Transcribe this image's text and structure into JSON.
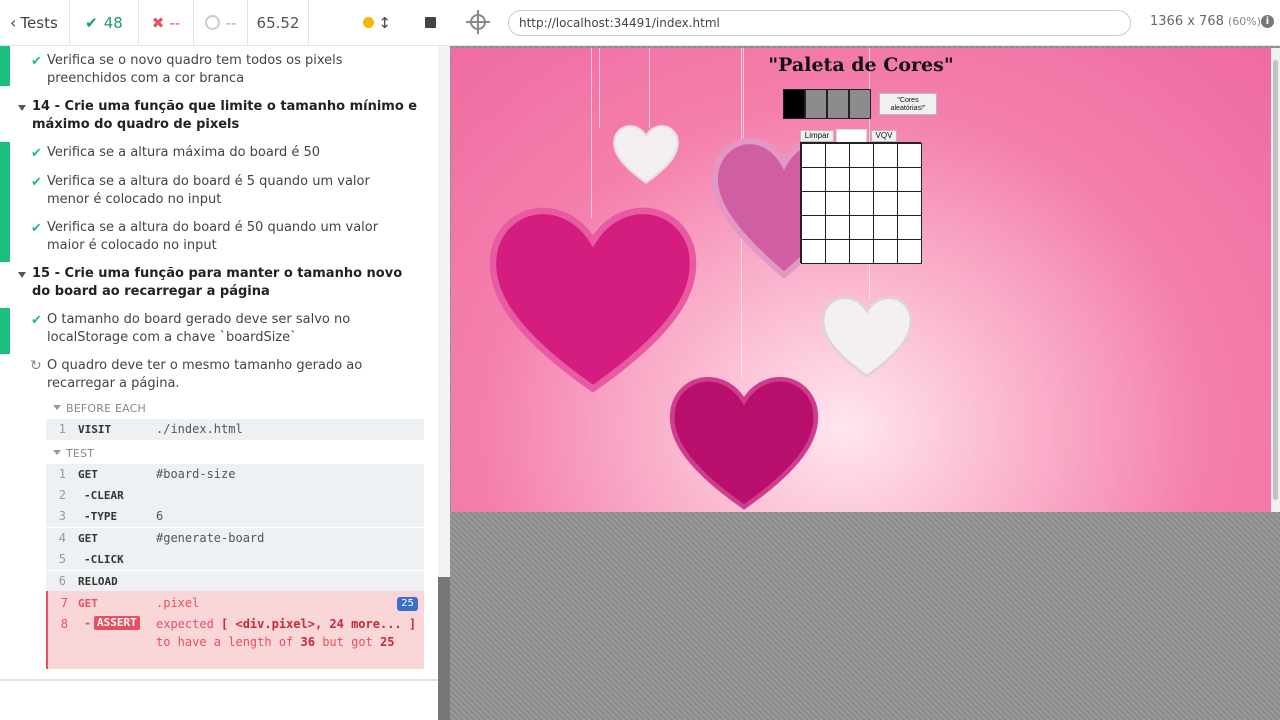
{
  "header": {
    "back_label": "Tests",
    "passed": "48",
    "failed": "--",
    "pending": "--",
    "duration": "65.52"
  },
  "tests": {
    "t13_last": "Verifica se o novo quadro tem todos os pixels preenchidos com a cor branca",
    "suite14": "14 - Crie uma função que limite o tamanho mínimo e máximo do quadro de pixels",
    "t14_1": "Verifica se a altura máxima do board é 50",
    "t14_2": "Verifica se a altura do board é 5 quando um valor menor é colocado no input",
    "t14_3": "Verifica se a altura do board é 50 quando um valor maior é colocado no input",
    "suite15": "15 - Crie uma função para manter o tamanho novo do board ao recarregar a página",
    "t15_1": "O tamanho do board gerado deve ser salvo no localStorage com a chave `boardSize`",
    "t15_2": "O quadro deve ter o mesmo tamanho gerado ao recarregar a página."
  },
  "hooks": {
    "before_each_label": "BEFORE EACH",
    "test_label": "TEST"
  },
  "before_each_cmds": [
    {
      "num": "1",
      "name": "VISIT",
      "arg": "./index.html"
    }
  ],
  "test_cmds": [
    {
      "num": "1",
      "name": "GET",
      "arg": "#board-size"
    },
    {
      "num": "2",
      "name": "-CLEAR",
      "arg": ""
    },
    {
      "num": "3",
      "name": "-TYPE",
      "arg": "6"
    },
    {
      "num": "4",
      "name": "GET",
      "arg": "#generate-board"
    },
    {
      "num": "5",
      "name": "-CLICK",
      "arg": ""
    },
    {
      "num": "6",
      "name": "RELOAD",
      "arg": ""
    }
  ],
  "failed_cmd": {
    "num7": "7",
    "name7": "GET",
    "arg7": ".pixel",
    "badge": "25",
    "num8": "8",
    "assert_label": "ASSERT",
    "msg_expected": "expected",
    "msg_subject": "[ <div.pixel>, 24 more... ]",
    "msg_mid": "to have a length of",
    "msg_expected_val": "36",
    "msg_but": "but got",
    "msg_actual": "25"
  },
  "aut": {
    "url": "http://localhost:34491/index.html",
    "viewport": "1366 x 768",
    "zoom": "(60%)",
    "info": "i"
  },
  "app": {
    "title": "\"Paleta de Cores\"",
    "palette_colors": [
      "#000000",
      "#8c8c8c",
      "#8c8c8c",
      "#8c8c8c"
    ],
    "random_btn": "\"Cores aleatórias!\"",
    "clear_btn": "Limpar",
    "vqv_btn": "VQV",
    "board_cells": 25
  }
}
